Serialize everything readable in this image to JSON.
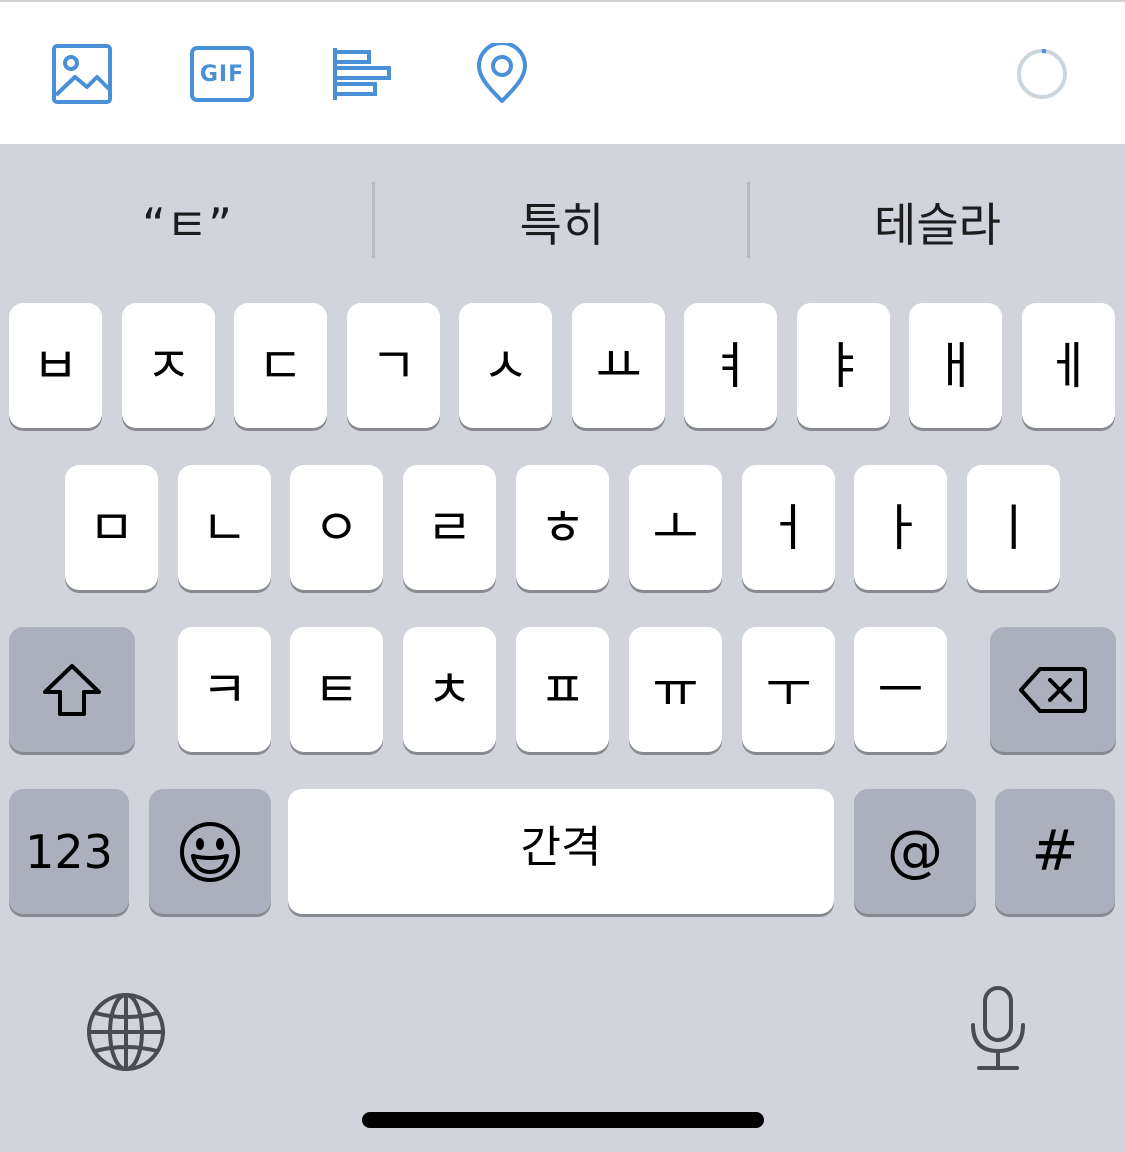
{
  "toolbar": {
    "icons": [
      "image-icon",
      "gif-icon",
      "poll-icon",
      "location-icon"
    ],
    "gif_label": "GIF",
    "accent_color": "#4a90d9"
  },
  "suggestions": [
    "“ㅌ”",
    "특히",
    "테슬라"
  ],
  "keyboard": {
    "row1": [
      "ㅂ",
      "ㅈ",
      "ㄷ",
      "ㄱ",
      "ㅅ",
      "ㅛ",
      "ㅕ",
      "ㅑ",
      "ㅐ",
      "ㅔ"
    ],
    "row2": [
      "ㅁ",
      "ㄴ",
      "ㅇ",
      "ㄹ",
      "ㅎ",
      "ㅗ",
      "ㅓ",
      "ㅏ",
      "ㅣ"
    ],
    "row3": [
      "ㅋ",
      "ㅌ",
      "ㅊ",
      "ㅍ",
      "ㅠ",
      "ㅜ",
      "ㅡ"
    ],
    "numbers_label": "123",
    "space_label": "간격",
    "at_label": "@",
    "hash_label": "#"
  }
}
